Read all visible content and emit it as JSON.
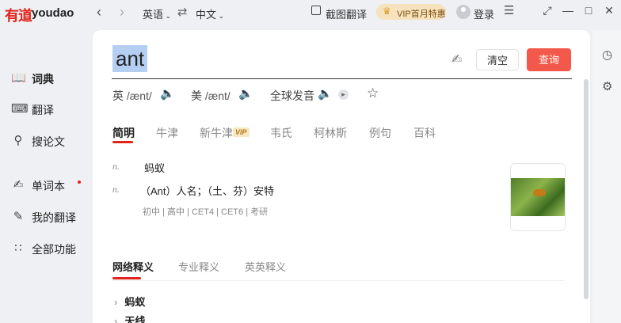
{
  "topbar": {
    "logo_text": "有道",
    "brand": "youdao",
    "source_lang": "英语",
    "target_lang": "中文",
    "capture_label": "截图翻译",
    "vip_label": "VIP首月特惠",
    "login_label": "登录"
  },
  "sidebar": {
    "items": [
      {
        "label": "词典",
        "icon": "dictionary-icon"
      },
      {
        "label": "翻译",
        "icon": "translate-icon"
      },
      {
        "label": "搜论文",
        "icon": "paper-search-icon"
      },
      {
        "label": "单词本",
        "icon": "wordbook-icon"
      },
      {
        "label": "我的翻译",
        "icon": "my-translation-icon"
      },
      {
        "label": "全部功能",
        "icon": "all-features-icon"
      }
    ]
  },
  "search": {
    "word": "ant",
    "clear_label": "清空",
    "query_label": "查询"
  },
  "pronunciation": {
    "uk_label": "英",
    "uk_phonetic": "/ænt/",
    "us_label": "美",
    "us_phonetic": "/ænt/",
    "global_label": "全球发音"
  },
  "tabs": [
    "简明",
    "牛津",
    "新牛津",
    "韦氏",
    "柯林斯",
    "例句",
    "百科"
  ],
  "vip_badge": "VIP",
  "definitions": [
    {
      "pos": "n.",
      "text": "蚂蚁"
    },
    {
      "pos": "n.",
      "text": "（Ant）人名；（土、芬）安特"
    }
  ],
  "level_tags": "初中 | 高中 | CET4 | CET6 | 考研",
  "web_tabs": [
    "网络释义",
    "专业释义",
    "英英释义"
  ],
  "web_items": [
    "蚂蚁",
    "天线"
  ],
  "colors": {
    "accent": "#e2231a",
    "query_button": "#f3594a",
    "selection": "#b5cff3",
    "vip_bg": "#f6e3bd"
  }
}
